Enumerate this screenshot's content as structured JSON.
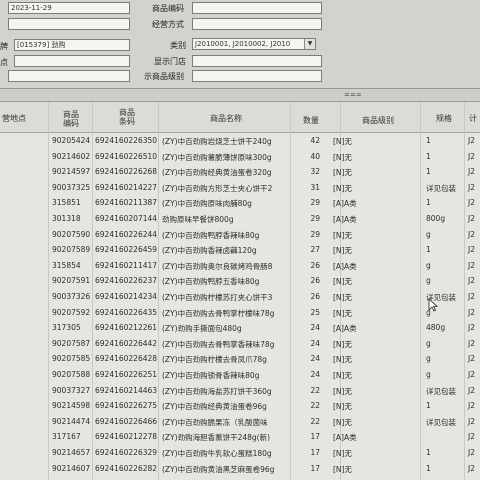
{
  "form": {
    "date_value": "2023-11-29",
    "label_product_code": "商品编码",
    "label_operation": "经营方式",
    "label_brand": "牌",
    "brand_value": "[015379] 劲购",
    "label_category": "类别",
    "category_value": "J2010001, J2010002, J2010",
    "label_store_point": "点",
    "label_show_store": "显示门店",
    "label_product_level": "示商品级别"
  },
  "grid": {
    "headers": {
      "dept": "营地点",
      "code": "商品\n编码",
      "barcode": "商品\n条码",
      "name": "商品名称",
      "qty": "数量",
      "level": "商品级别",
      "spec": "规格",
      "last": "计"
    },
    "rows": [
      {
        "code": "90205424",
        "barcode": "6924160226350",
        "name": "(ZY)中百劲购岩烧芝士饼干240g",
        "qty": "42",
        "level": "[N]无",
        "spec": "1",
        "last": "J2"
      },
      {
        "code": "90214602",
        "barcode": "6924160226510",
        "name": "(ZY)中百劲购薯脆薄饼原味300g",
        "qty": "40",
        "level": "[N]无",
        "spec": "1",
        "last": "J2"
      },
      {
        "code": "90214597",
        "barcode": "6924160226268",
        "name": "(ZY)中百劲购经典黄油蛋卷320g",
        "qty": "32",
        "level": "[N]无",
        "spec": "1",
        "last": "J2"
      },
      {
        "code": "90037325",
        "barcode": "6924160214227",
        "name": "(ZY)中百劲购方形芝士夹心饼干2",
        "qty": "31",
        "level": "[N]无",
        "spec": "详见包装",
        "last": "J2"
      },
      {
        "code": "315851",
        "barcode": "6924160211387",
        "name": "(ZY)中百劲购原味肉脯80g",
        "qty": "29",
        "level": "[A]A类",
        "spec": "1",
        "last": "J2"
      },
      {
        "code": "301318",
        "barcode": "6924160207144",
        "name": "劲购原味早餐饼800g",
        "qty": "29",
        "level": "[A]A类",
        "spec": "800g",
        "last": "J2"
      },
      {
        "code": "90207590",
        "barcode": "6924160226244",
        "name": "(ZY)中百劲购鸭脖香辣味80g",
        "qty": "29",
        "level": "[N]无",
        "spec": "g",
        "last": "J2"
      },
      {
        "code": "90207589",
        "barcode": "6924160226459",
        "name": "(ZY)中百劲购香辣卤藕120g",
        "qty": "27",
        "level": "[N]无",
        "spec": "1",
        "last": "J2"
      },
      {
        "code": "315854",
        "barcode": "6924160211417",
        "name": "(ZY)中百劲购奥尔良碳烤鸡骨肠8",
        "qty": "26",
        "level": "[A]A类",
        "spec": "g",
        "last": "J2"
      },
      {
        "code": "90207591",
        "barcode": "6924160226237",
        "name": "(ZY)中百劲购鸭脖五香味80g",
        "qty": "26",
        "level": "[N]无",
        "spec": "g",
        "last": "J2"
      },
      {
        "code": "90037326",
        "barcode": "6924160214234",
        "name": "(ZY)中百劲购柠檬苏打夹心饼干3",
        "qty": "26",
        "level": "[N]无",
        "spec": "详见包装",
        "last": "J2"
      },
      {
        "code": "90207592",
        "barcode": "6924160226435",
        "name": "(ZY)中百劲购去骨鸭掌柠檬味78g",
        "qty": "25",
        "level": "[N]无",
        "spec": "g",
        "last": "J2"
      },
      {
        "code": "317305",
        "barcode": "6924160212261",
        "name": "(ZY)劲购手撕面包480g",
        "qty": "24",
        "level": "[A]A类",
        "spec": "480g",
        "last": "J2"
      },
      {
        "code": "90207587",
        "barcode": "6924160226442",
        "name": "(ZY)中百劲购去骨鸭掌香辣味78g",
        "qty": "24",
        "level": "[N]无",
        "spec": "g",
        "last": "J2"
      },
      {
        "code": "90207585",
        "barcode": "6924160226428",
        "name": "(ZY)中百劲购柠檬去骨凤爪78g",
        "qty": "24",
        "level": "[N]无",
        "spec": "g",
        "last": "J2"
      },
      {
        "code": "90207588",
        "barcode": "6924160226251",
        "name": "(ZY)中百劲购锁骨香辣味80g",
        "qty": "24",
        "level": "[N]无",
        "spec": "g",
        "last": "J2"
      },
      {
        "code": "90037327",
        "barcode": "6924160214463",
        "name": "(ZY)中百劲购海盐苏打饼干360g",
        "qty": "22",
        "level": "[N]无",
        "spec": "详见包装",
        "last": "J2"
      },
      {
        "code": "90214598",
        "barcode": "6924160226275",
        "name": "(ZY)中百劲购经典黄油蛋卷96g",
        "qty": "22",
        "level": "[N]无",
        "spec": "1",
        "last": "J2"
      },
      {
        "code": "90214474",
        "barcode": "6924160226466",
        "name": "(ZY)中百劲购脆果冻（乳酸菌味",
        "qty": "22",
        "level": "[N]无",
        "spec": "详见包装",
        "last": "J2"
      },
      {
        "code": "317167",
        "barcode": "6924160212278",
        "name": "(ZY)劲购海胆香薰饼干248g(新)",
        "qty": "17",
        "level": "[A]A类",
        "spec": "",
        "last": "J2"
      },
      {
        "code": "90214657",
        "barcode": "6924160226329",
        "name": "(ZY)中百劲购牛乳软心蛋糕180g",
        "qty": "17",
        "level": "[N]无",
        "spec": "1",
        "last": "J2"
      },
      {
        "code": "90214607",
        "barcode": "6924160226282",
        "name": "(ZY)中百劲购黄油黑芝麻蛋卷96g",
        "qty": "17",
        "level": "[N]无",
        "spec": "1",
        "last": "J2"
      }
    ]
  },
  "splitter": {
    "handle": "==="
  },
  "cursor_icon": "mouse-pointer-icon",
  "dropdown_icon": "chevron-down-icon"
}
